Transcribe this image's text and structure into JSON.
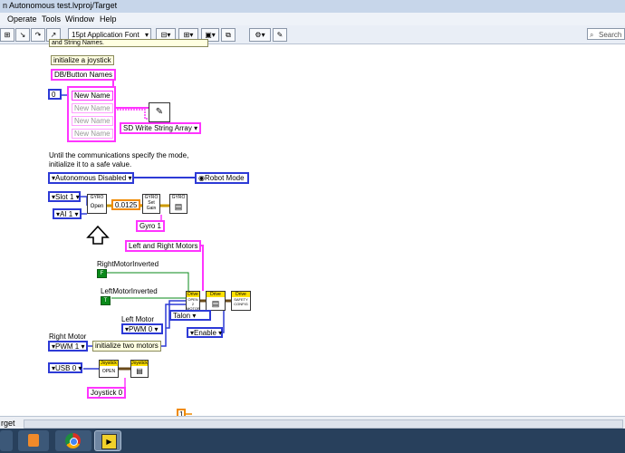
{
  "window": {
    "title": "n Autonomous test.lvproj/Target"
  },
  "menu": {
    "items": [
      "Operate",
      "Tools",
      "Window",
      "Help"
    ]
  },
  "toolbar": {
    "font": "15pt Application Font",
    "search_placeholder": "Search"
  },
  "diagram": {
    "top_comment": "and String Names.",
    "init_joystick_comment": "initialize a joystick",
    "db_button_names": "DB/Button Names",
    "index_value": "0",
    "names": [
      "New Name",
      "New Name",
      "New Name",
      "New Name"
    ],
    "sd_write": "SD Write String Array",
    "mode_comment_1": "Until the communications specify the mode,",
    "mode_comment_2": "initialize it to a safe value.",
    "mode_value": "Autonomous Disabled",
    "robot_mode": "Robot Mode",
    "slot": "Slot 1",
    "ai": "AI 1",
    "gyro_gain": "0.0125",
    "gyro_open_hd": "GYRO",
    "gyro_open": "Open",
    "gyro_setgain_hd": "GYRO",
    "gyro_setgain": "Set Gain",
    "gyro_ref_hd": "GYRO",
    "gyro_name": "Gyro 1",
    "motors_name": "Left and Right Motors",
    "right_inverted_label": "RightMotorInverted",
    "right_inverted_value": "F",
    "left_inverted_label": "LeftMotorInverted",
    "left_inverted_value": "T",
    "drive_hd": "Drive",
    "drive_open": "OPEN 2 MOTOR",
    "safety_config": "SAFETY CONFIG",
    "talon": "Talon",
    "enable": "Enable",
    "left_motor_label": "Left Motor",
    "left_pwm": "PWM 0",
    "right_motor_label": "Right Motor",
    "right_pwm": "PWM 1",
    "init_motors_comment": "initialize two motors",
    "usb": "USB 0",
    "joystick_hd": "Joystick",
    "joystick_open": "OPEN",
    "joystick_name": "Joystick 0",
    "bottom_const": "1"
  },
  "status": {
    "target": "rget"
  }
}
